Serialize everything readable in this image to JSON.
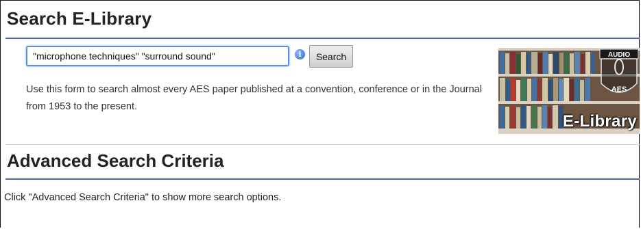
{
  "header": {
    "title": "Search E-Library"
  },
  "search": {
    "value": "\"microphone techniques\" \"surround sound\"",
    "info_icon": "info-icon",
    "button_label": "Search",
    "description": "Use this form to search almost every AES paper published at a convention, conference or in the Journal from 1953 to the present."
  },
  "banner": {
    "label": "E-Library",
    "logo_top": "AUDIO",
    "logo_middle": "AES"
  },
  "advanced": {
    "title": "Advanced Search Criteria",
    "hint": "Click \"Advanced Search Criteria\" to show more search options."
  },
  "colors": {
    "rule": "#4a6a9b",
    "input_border": "#5b8ed6"
  }
}
